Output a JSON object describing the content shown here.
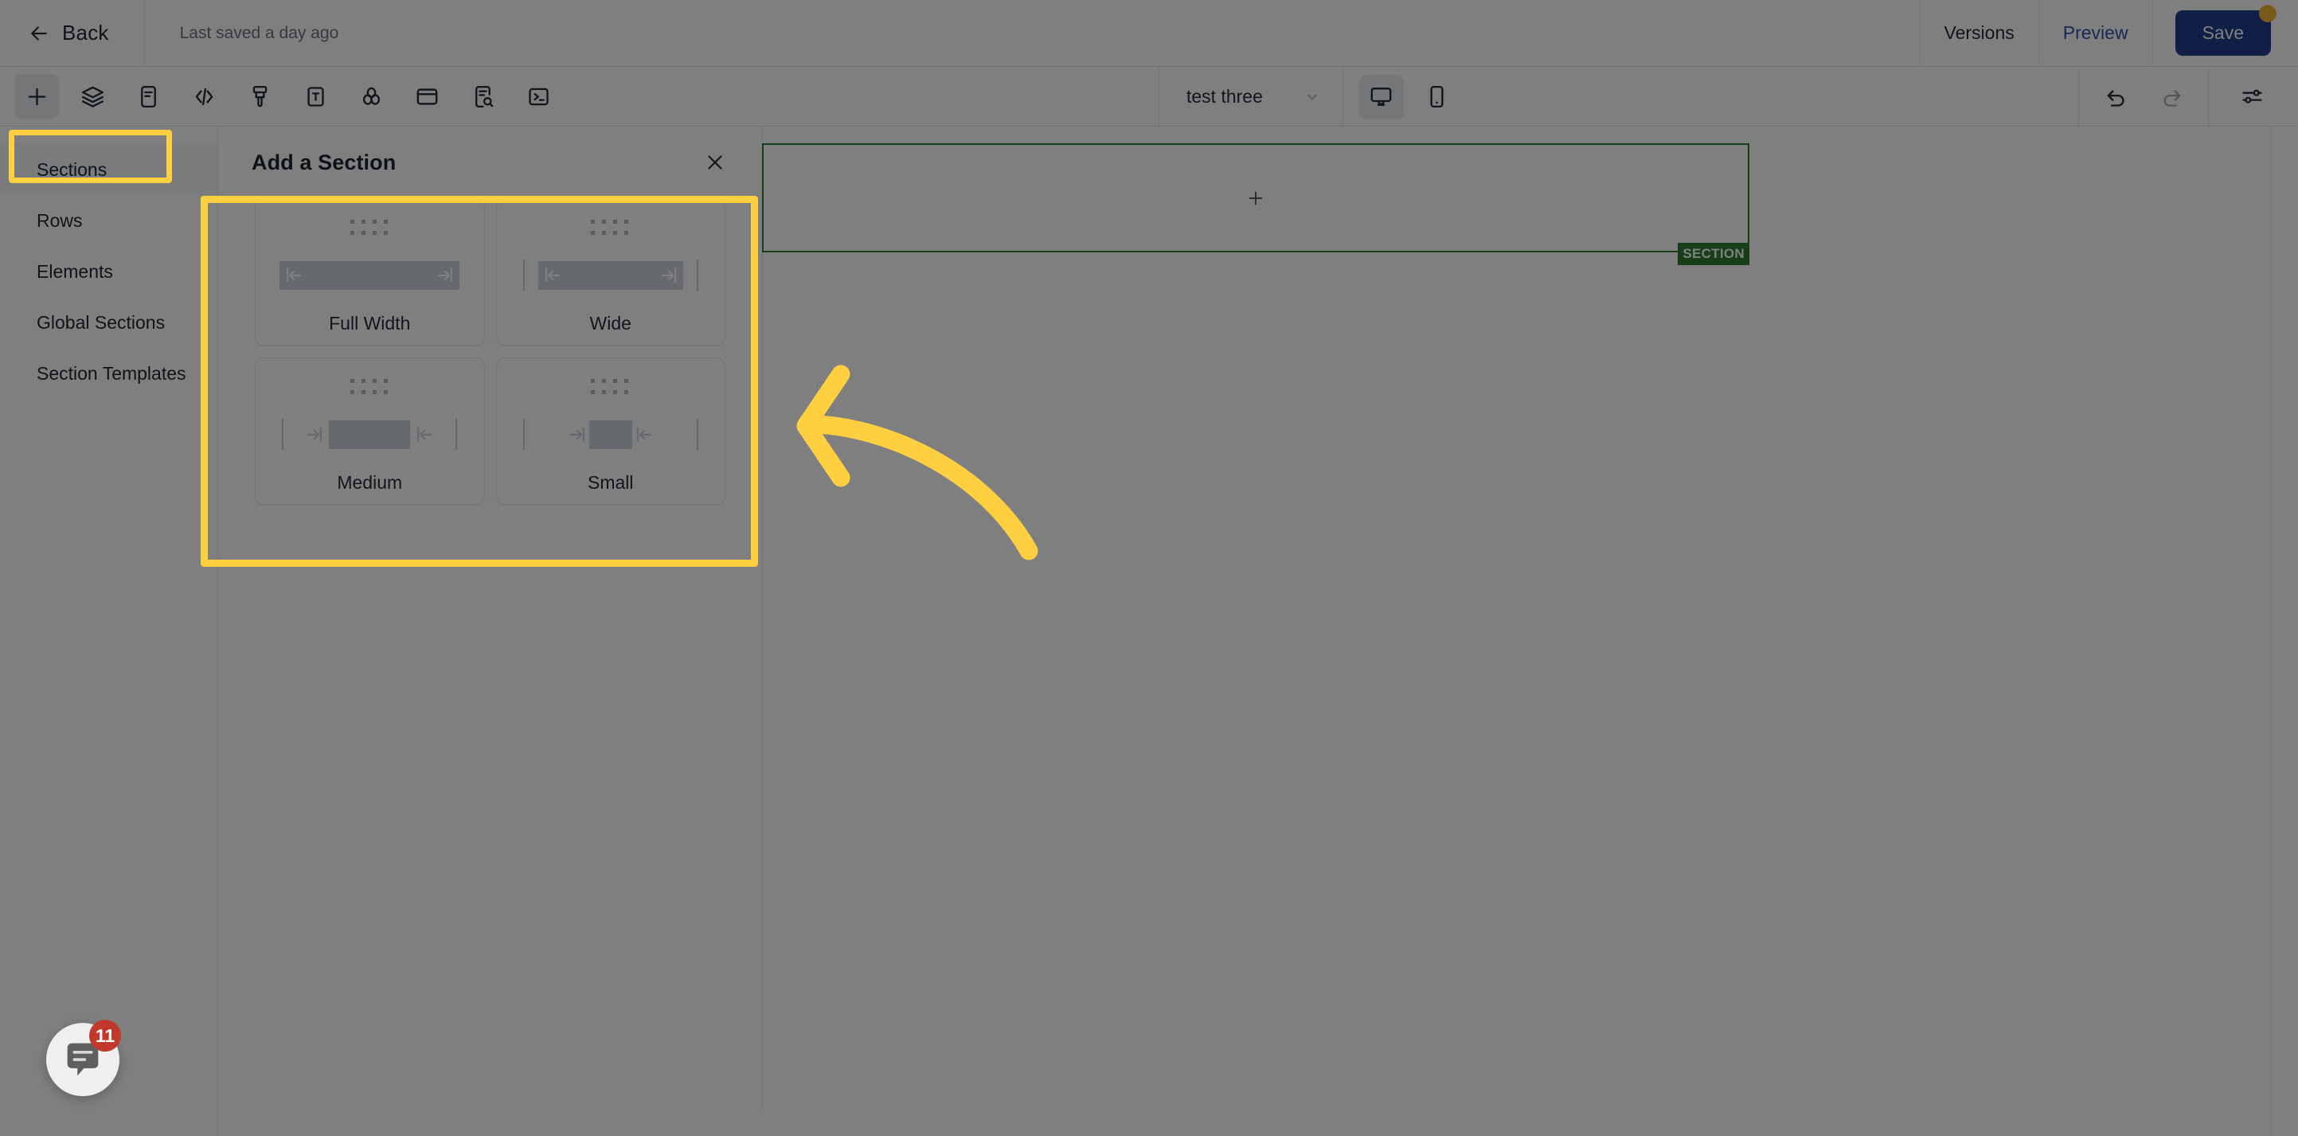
{
  "topbar": {
    "back_label": "Back",
    "back_icon": "arrow-left-icon",
    "saved_text": "Last saved a day ago",
    "versions_label": "Versions",
    "preview_label": "Preview",
    "save_label": "Save",
    "save_badge_color": "#f1b434",
    "save_button_color": "#1f3e8c",
    "preview_link_color": "#2d55a8"
  },
  "toolbar": {
    "left_tools": [
      {
        "name": "add-icon",
        "active": true
      },
      {
        "name": "layers-icon",
        "active": false
      },
      {
        "name": "document-icon",
        "active": false
      },
      {
        "name": "code-icon",
        "active": false
      },
      {
        "name": "brush-icon",
        "active": false
      },
      {
        "name": "text-icon",
        "active": false
      },
      {
        "name": "color-blend-icon",
        "active": false
      },
      {
        "name": "card-icon",
        "active": false
      },
      {
        "name": "document-search-icon",
        "active": false
      },
      {
        "name": "terminal-icon",
        "active": false
      }
    ],
    "page_name": "test three",
    "page_chevron": "chevron-down-icon",
    "viewport_tools": [
      {
        "name": "desktop-icon",
        "active": true
      },
      {
        "name": "mobile-icon",
        "active": false
      }
    ],
    "right_tools": [
      {
        "name": "undo-icon",
        "enabled": true
      },
      {
        "name": "redo-icon",
        "enabled": false
      },
      {
        "name": "settings-sliders-icon",
        "enabled": true
      }
    ]
  },
  "sidebar": {
    "items": [
      {
        "label": "Sections",
        "selected": true
      },
      {
        "label": "Rows",
        "selected": false
      },
      {
        "label": "Elements",
        "selected": false
      },
      {
        "label": "Global Sections",
        "selected": false
      },
      {
        "label": "Section Templates",
        "selected": false
      }
    ]
  },
  "panel": {
    "title": "Add a Section",
    "close_icon": "close-icon",
    "cards": [
      {
        "label": "Full Width",
        "variant": "full"
      },
      {
        "label": "Wide",
        "variant": "wide"
      },
      {
        "label": "Medium",
        "variant": "medium"
      },
      {
        "label": "Small",
        "variant": "small"
      }
    ]
  },
  "canvas": {
    "section_tag": "SECTION",
    "section_outline_color": "#2f7d32",
    "add_block_icon": "plus-icon"
  },
  "chat": {
    "icon": "chat-bubble-icon",
    "badge_count": "11",
    "badge_color": "#c0392b"
  },
  "annotations": {
    "highlight_color": "#fdcf41",
    "boxes": [
      {
        "name": "sidebar-sections-highlight"
      },
      {
        "name": "section-cards-highlight"
      }
    ],
    "arrow": {
      "name": "pointer-arrow",
      "direction": "left"
    }
  }
}
